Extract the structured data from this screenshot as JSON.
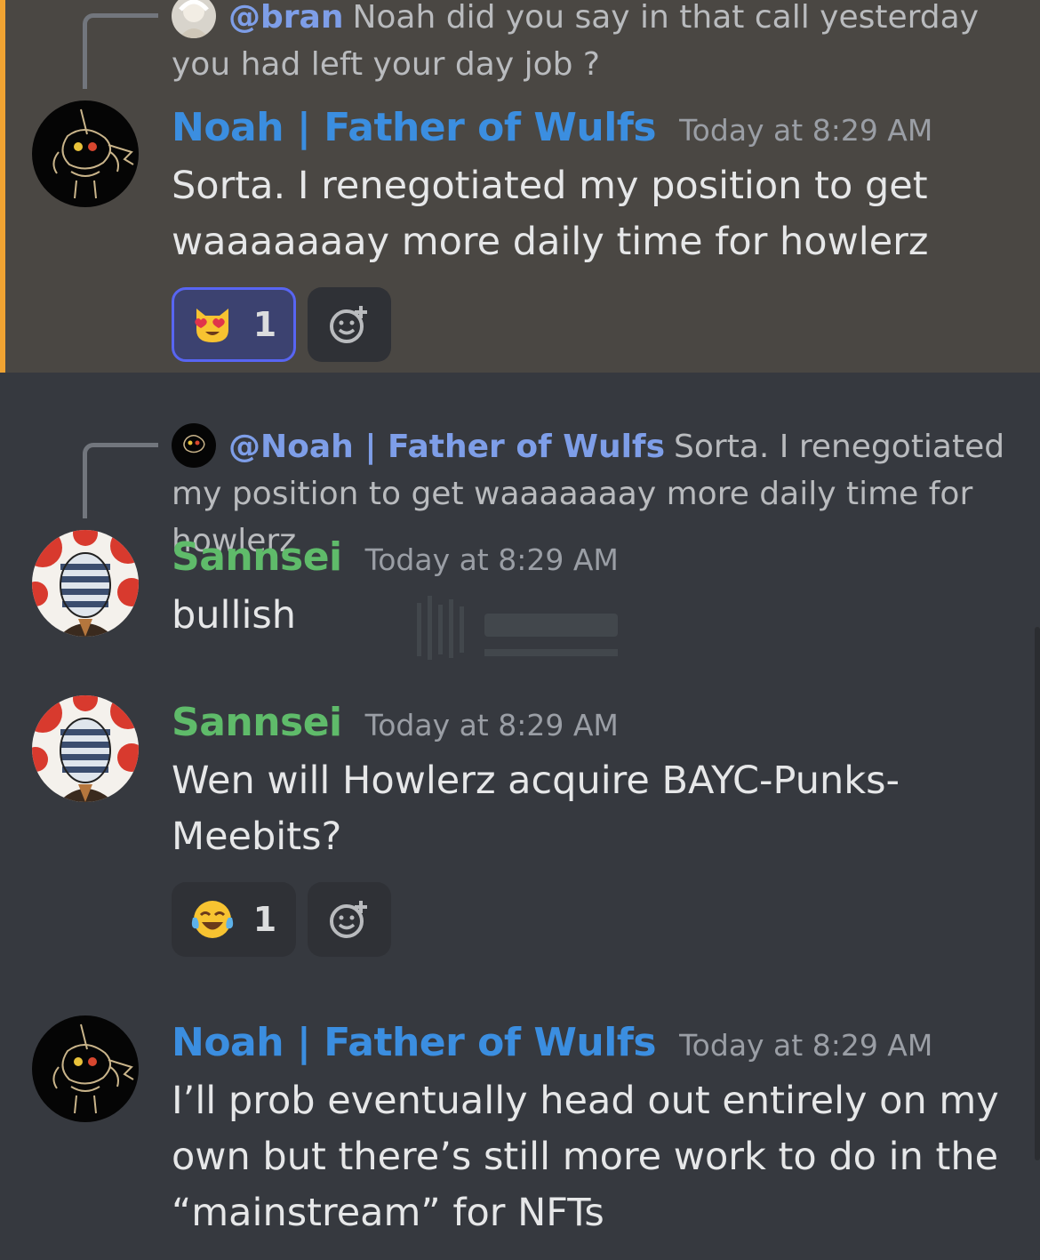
{
  "messages": [
    {
      "reply": {
        "mention": "@bran",
        "text": "Noah did you say in that call yesterday you had left your day job ?",
        "avatar_icon": "bran-avatar"
      },
      "author": "Noah | Father of Wulfs",
      "author_color": "#3b8ee0",
      "timestamp": "Today at 8:29 AM",
      "text": "Sorta. I renegotiated my position to get waaaaaaay more daily time for howlerz",
      "reaction": {
        "emoji": "heart-eyes-cat-emoji",
        "count": "1",
        "active": true
      }
    },
    {
      "reply": {
        "mention": "@Noah | Father of Wulfs",
        "text": "Sorta. I renegotiated my position to get waaaaaaay more daily time for howlerz",
        "avatar_icon": "noah-avatar"
      },
      "author": "Sannsei",
      "author_color": "#5fbb6a",
      "timestamp": "Today at 8:29 AM",
      "text": "bullish"
    },
    {
      "author": "Sannsei",
      "author_color": "#5fbb6a",
      "timestamp": "Today at 8:29 AM",
      "text": "Wen will Howlerz acquire BAYC-Punks-Meebits?",
      "reaction": {
        "emoji": "joy-emoji",
        "count": "1",
        "active": false
      }
    },
    {
      "author": "Noah | Father of Wulfs",
      "author_color": "#3b8ee0",
      "timestamp": "Today at 8:29 AM",
      "text": "I’ll prob eventually head out entirely on my own but there’s still more work to do in the “mainstream” for NFTs"
    }
  ],
  "colors": {
    "highlight_bg": "#4a4743",
    "highlight_bar": "#f0a332",
    "bg": "#36393f"
  }
}
